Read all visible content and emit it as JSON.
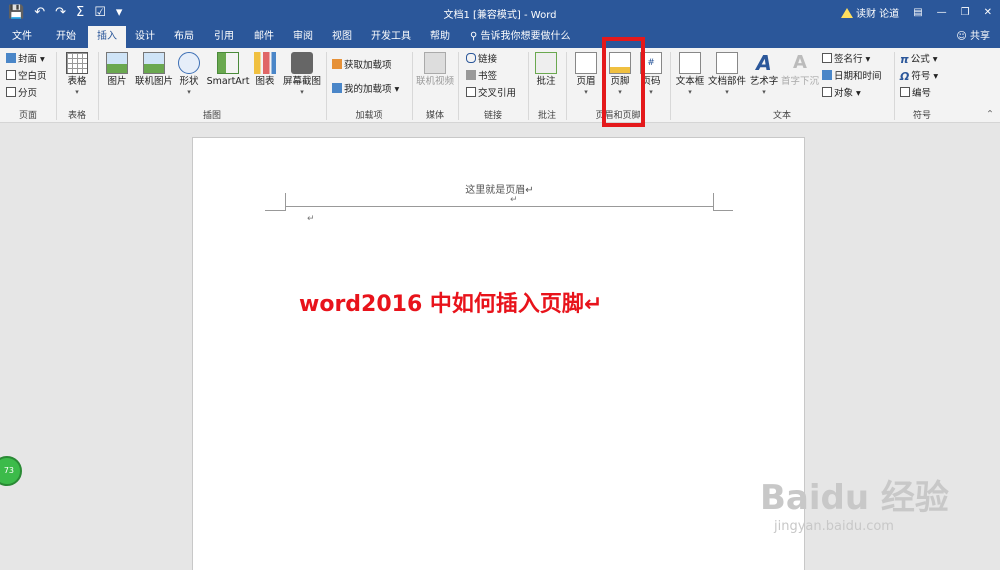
{
  "titlebar": {
    "title": "文档1 [兼容模式] - Word",
    "warning": "读财 论道",
    "qat": [
      "save-icon",
      "undo-icon",
      "redo-icon",
      "sigma-icon",
      "check-icon",
      "customize-icon"
    ]
  },
  "tabs": [
    "文件",
    "开始",
    "插入",
    "设计",
    "布局",
    "引用",
    "邮件",
    "审阅",
    "视图",
    "开发工具",
    "帮助"
  ],
  "active_tab": "插入",
  "tellme": "告诉我你想要做什么",
  "share": "共享",
  "ribbon": {
    "pages": {
      "items": [
        "封面",
        "空白页",
        "分页"
      ],
      "label": "页面"
    },
    "tables": {
      "button": "表格",
      "label": "表格"
    },
    "illustrations": {
      "buttons": [
        "图片",
        "联机图片",
        "形状",
        "SmartArt",
        "图表",
        "屏幕截图"
      ],
      "label": "插图"
    },
    "addins": {
      "items": [
        "获取加载项",
        "我的加载项"
      ],
      "label": "加载项"
    },
    "media": {
      "button": "联机视频",
      "label": "媒体"
    },
    "links": {
      "items": [
        "链接",
        "书签",
        "交叉引用"
      ],
      "label": "链接"
    },
    "comments": {
      "button": "批注",
      "label": "批注"
    },
    "header_footer": {
      "buttons": [
        "页眉",
        "页脚",
        "页码"
      ],
      "label": "页眉和页脚"
    },
    "text": {
      "buttons": [
        "文本框",
        "文档部件",
        "艺术字",
        "首字下沉"
      ],
      "items": [
        "签名行",
        "日期和时间",
        "对象"
      ],
      "label": "文本"
    },
    "symbols": {
      "items": [
        "公式",
        "符号",
        "编号"
      ],
      "label": "符号"
    }
  },
  "document": {
    "header_text": "这里就是页眉↵",
    "paragraph_mark": "↵",
    "headline": "word2016 中如何插入页脚↵"
  },
  "badge": "73",
  "watermark": {
    "brand": "Baidu 经验",
    "url": "jingyan.baidu.com"
  },
  "colors": {
    "brand": "#2b579a",
    "highlight": "#e4191b",
    "headline": "#e8131b"
  }
}
